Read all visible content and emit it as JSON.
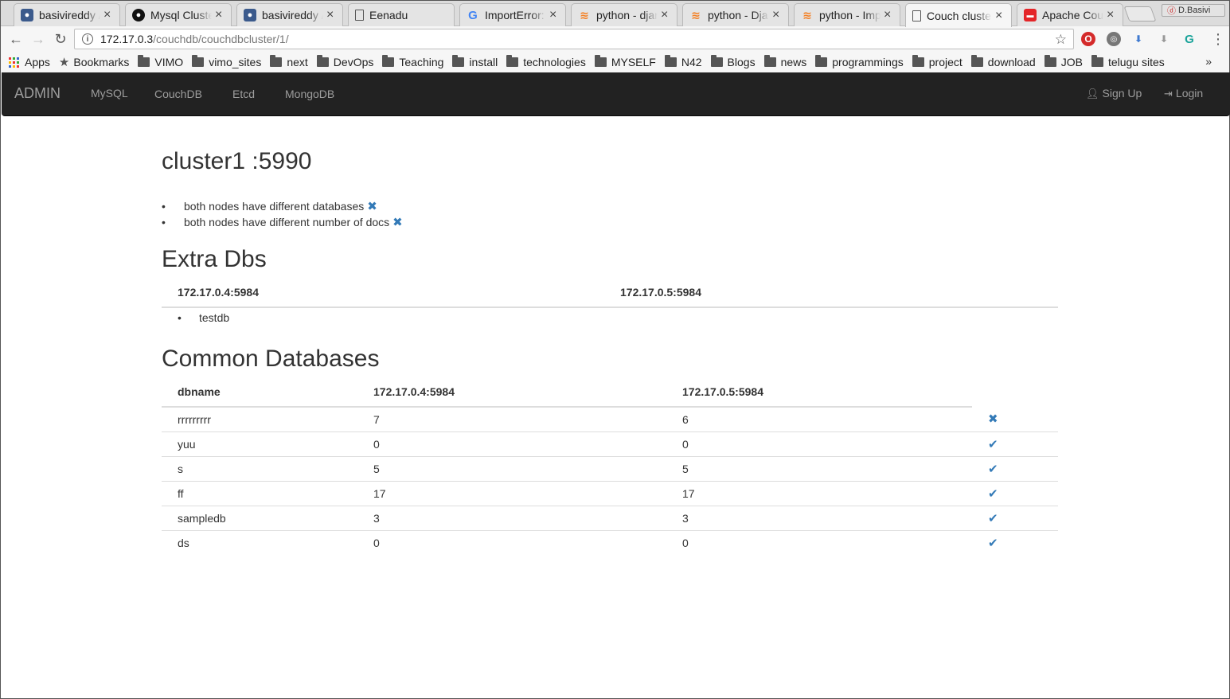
{
  "browser": {
    "tabs": [
      {
        "title": "basivireddy /",
        "favicon": "github-icon",
        "active": false
      },
      {
        "title": "Mysql Cluste",
        "favicon": "circle-icon",
        "active": false
      },
      {
        "title": "basivireddy /",
        "favicon": "github-icon",
        "active": false
      },
      {
        "title": "Eenadu",
        "favicon": "document-icon",
        "active": false
      },
      {
        "title": "ImportError:",
        "favicon": "google-icon",
        "active": false
      },
      {
        "title": "python - djan",
        "favicon": "stackoverflow-icon",
        "active": false
      },
      {
        "title": "python - Dja",
        "favicon": "stackoverflow-icon",
        "active": false
      },
      {
        "title": "python - Imp",
        "favicon": "stackoverflow-icon",
        "active": false
      },
      {
        "title": "Couch cluste",
        "favicon": "document-icon",
        "active": true
      },
      {
        "title": "Apache Cou",
        "favicon": "couchdb-icon",
        "active": false
      }
    ],
    "profile_name": "D.Basivi",
    "url_host": "172.17.0.3",
    "url_path": "/couchdb/couchdbcluster/1/",
    "bookmarks": [
      {
        "label": "Apps",
        "icon": "apps-grid-icon"
      },
      {
        "label": "Bookmarks",
        "icon": "star-icon"
      },
      {
        "label": "VIMO",
        "icon": "folder-icon"
      },
      {
        "label": "vimo_sites",
        "icon": "folder-icon"
      },
      {
        "label": "next",
        "icon": "folder-icon"
      },
      {
        "label": "DevOps",
        "icon": "folder-icon"
      },
      {
        "label": "Teaching",
        "icon": "folder-icon"
      },
      {
        "label": "install",
        "icon": "folder-icon"
      },
      {
        "label": "technologies",
        "icon": "folder-icon"
      },
      {
        "label": "MYSELF",
        "icon": "folder-icon"
      },
      {
        "label": "N42",
        "icon": "folder-icon"
      },
      {
        "label": "Blogs",
        "icon": "folder-icon"
      },
      {
        "label": "news",
        "icon": "folder-icon"
      },
      {
        "label": "programmings",
        "icon": "folder-icon"
      },
      {
        "label": "project",
        "icon": "folder-icon"
      },
      {
        "label": "download",
        "icon": "folder-icon"
      },
      {
        "label": "JOB",
        "icon": "folder-icon"
      },
      {
        "label": "telugu sites",
        "icon": "folder-icon"
      }
    ],
    "more_bookmarks": "»"
  },
  "navbar": {
    "brand": "ADMIN",
    "links": [
      "MySQL",
      "CouchDB",
      "Etcd",
      "MongoDB"
    ],
    "signup": "Sign Up",
    "login": "Login"
  },
  "page": {
    "title": "cluster1 :5990",
    "issues": [
      "both nodes have different databases",
      "both nodes have different number of docs"
    ],
    "extra_heading": "Extra Dbs",
    "extra_columns": [
      "172.17.0.4:5984",
      "172.17.0.5:5984"
    ],
    "extra_items": [
      "testdb"
    ],
    "common_heading": "Common Databases",
    "common_columns": [
      "dbname",
      "172.17.0.4:5984",
      "172.17.0.5:5984",
      ""
    ],
    "common_rows": [
      {
        "dbname": "rrrrrrrrr",
        "node1": "7",
        "node2": "6",
        "match": false
      },
      {
        "dbname": "yuu",
        "node1": "0",
        "node2": "0",
        "match": true
      },
      {
        "dbname": "s",
        "node1": "5",
        "node2": "5",
        "match": true
      },
      {
        "dbname": "ff",
        "node1": "17",
        "node2": "17",
        "match": true
      },
      {
        "dbname": "sampledb",
        "node1": "3",
        "node2": "3",
        "match": true
      },
      {
        "dbname": "ds",
        "node1": "0",
        "node2": "0",
        "match": true
      }
    ]
  },
  "colors": {
    "accent": "#337ab7",
    "navbar_bg": "#222222",
    "navbar_text": "#9d9d9d"
  }
}
